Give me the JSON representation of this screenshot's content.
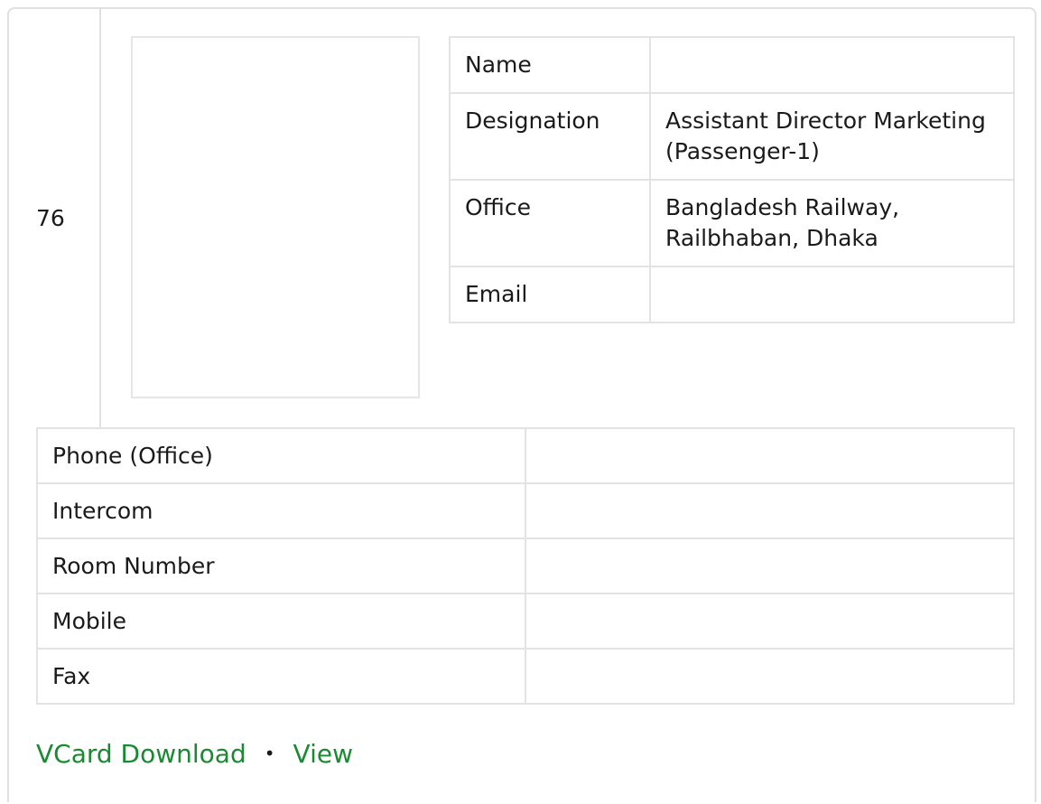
{
  "row_number": "76",
  "info": {
    "rows": [
      {
        "label": "Name",
        "value": ""
      },
      {
        "label": "Designation",
        "value": "Assistant Director Marketing (Passenger-1)"
      },
      {
        "label": "Office",
        "value": "Bangladesh Railway, Railbhaban, Dhaka"
      },
      {
        "label": "Email",
        "value": ""
      }
    ]
  },
  "contact": {
    "rows": [
      {
        "label": "Phone (Office)",
        "value": ""
      },
      {
        "label": "Intercom",
        "value": ""
      },
      {
        "label": "Room Number",
        "value": ""
      },
      {
        "label": "Mobile",
        "value": ""
      },
      {
        "label": "Fax",
        "value": ""
      }
    ]
  },
  "links": {
    "vcard_label": "VCard Download",
    "separator": "•",
    "view_label": "View",
    "link_color": "#1a8a32"
  }
}
